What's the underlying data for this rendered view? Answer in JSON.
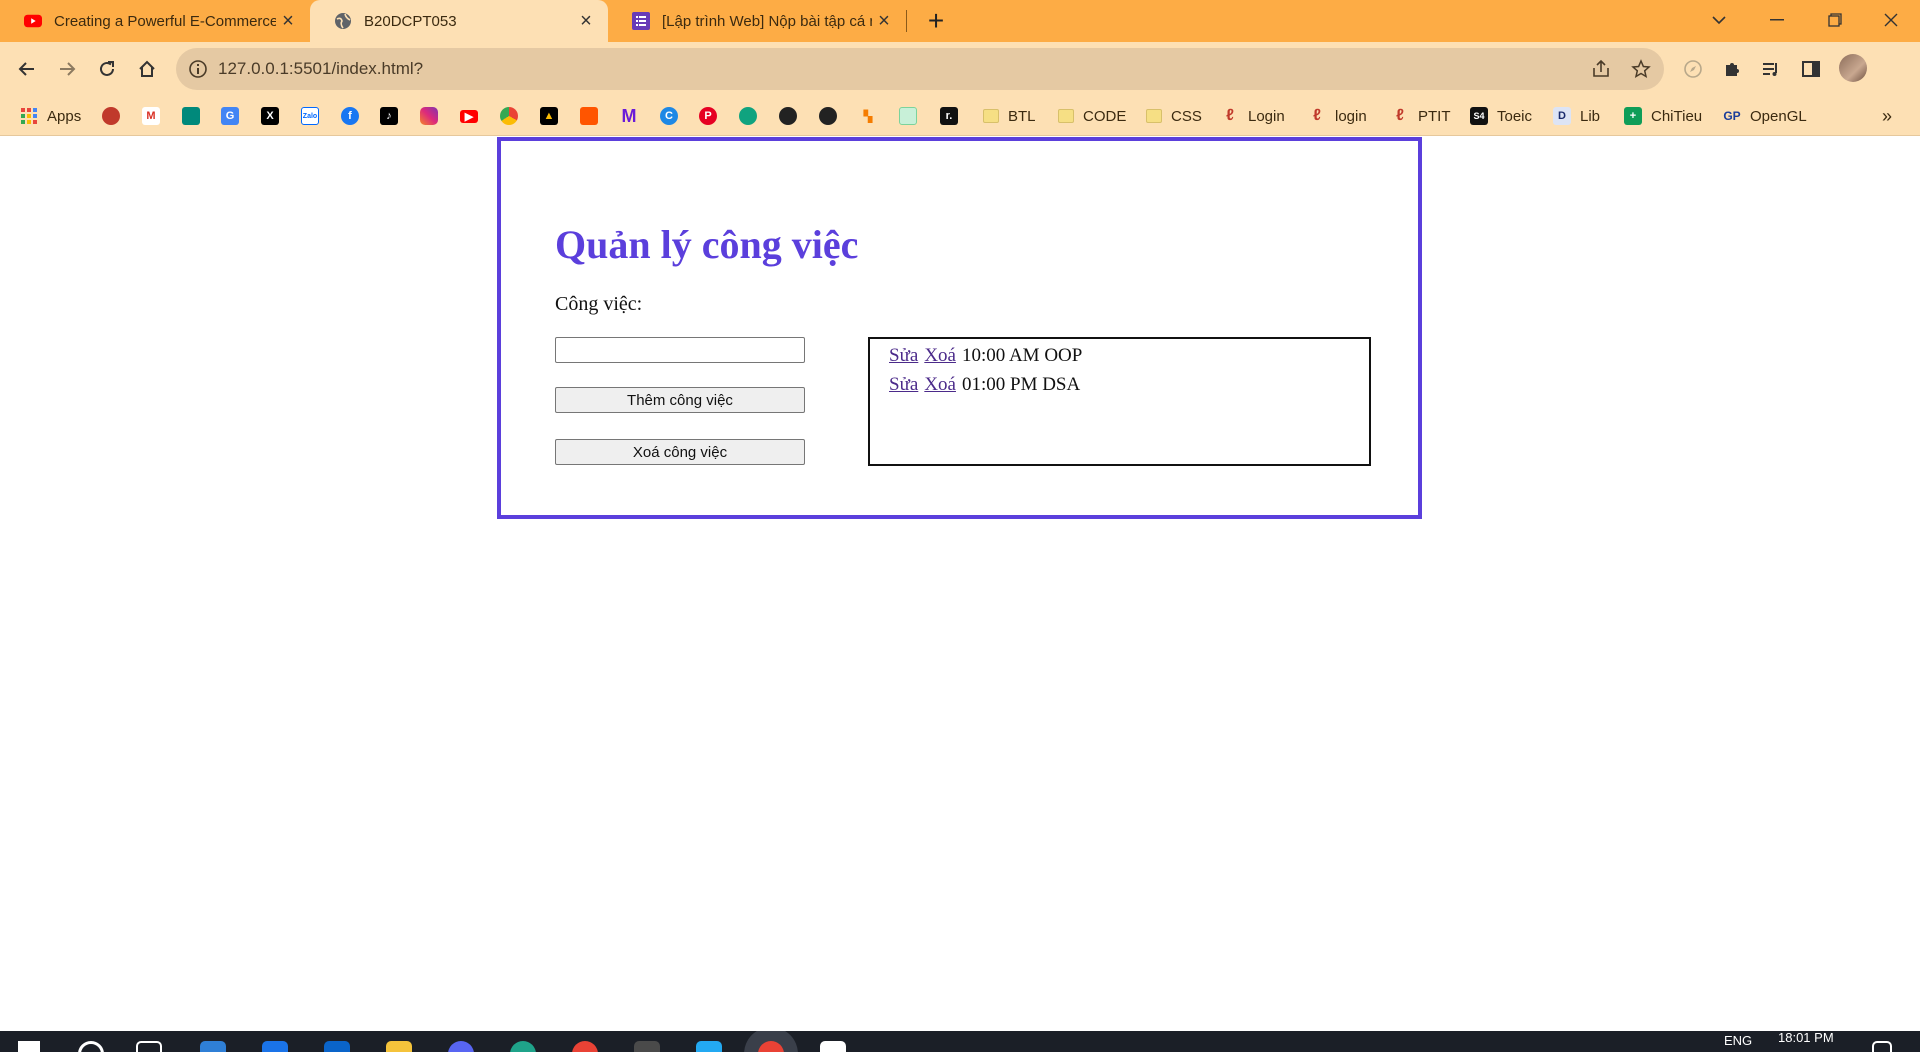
{
  "browser": {
    "tabs": [
      {
        "title": "Creating a Powerful E-Commerce",
        "icon": "youtube-icon",
        "active": false
      },
      {
        "title": "B20DCPT053",
        "icon": "globe-icon",
        "active": true
      },
      {
        "title": "[Lập trình Web] Nộp bài tập cá n",
        "icon": "forms-icon",
        "active": false
      }
    ],
    "url": "127.0.0.1:5501/index.html?",
    "bookmarks": {
      "apps": "Apps",
      "btl": "BTL",
      "code": "CODE",
      "css": "CSS",
      "login1": "Login",
      "login2": "login",
      "ptit": "PTIT",
      "toeic": "Toeic",
      "lib": "Lib",
      "chitieu": "ChiTieu",
      "opengl": "OpenGL"
    },
    "accent_color": "#fdac45"
  },
  "app": {
    "title": "Quản lý công việc",
    "label": "Công việc:",
    "input_value": "",
    "add_button": "Thêm công việc",
    "delete_button": "Xoá công việc",
    "edit_link": "Sửa",
    "remove_link": "Xoá",
    "tasks": [
      {
        "text": "10:00 AM OOP"
      },
      {
        "text": "01:00 PM DSA"
      }
    ],
    "border_color": "#5b3fdc"
  },
  "taskbar": {
    "language": "ENG",
    "time": "18:01 PM"
  }
}
